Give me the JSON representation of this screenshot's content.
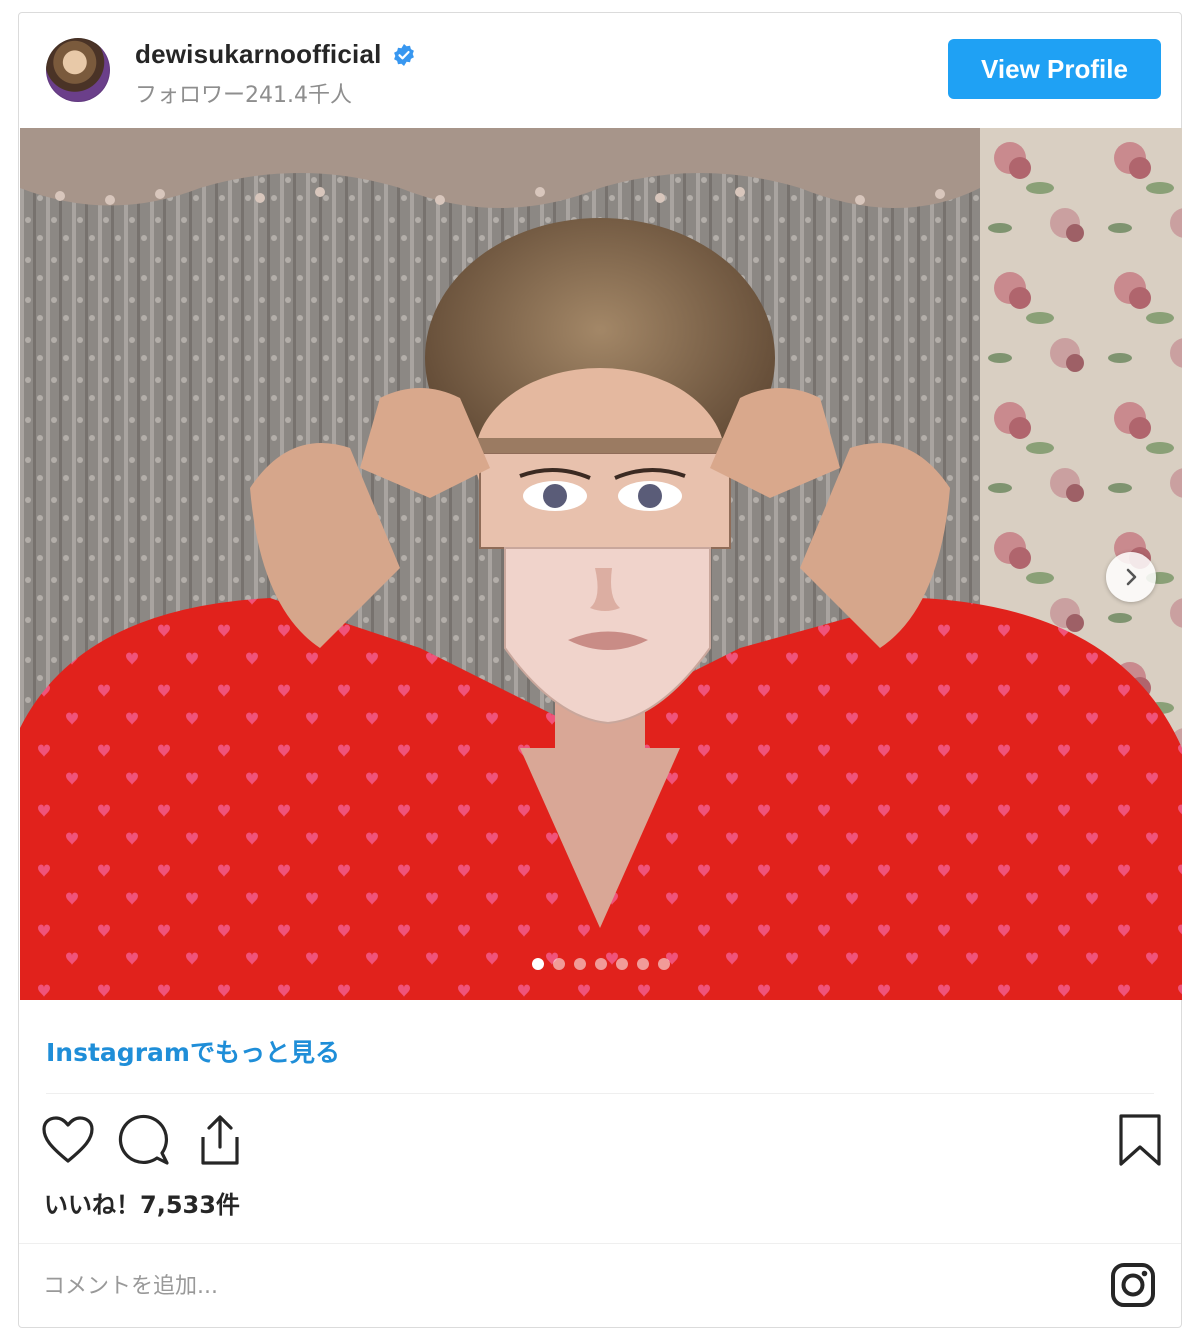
{
  "post": {
    "username": "dewisukarnoofficial",
    "followers": "フォロワー241.4千人",
    "view_profile_label": "View Profile"
  },
  "carousel": {
    "slide_count": 7,
    "active_index": 0
  },
  "more_link": "Instagramでもっと見る",
  "likes": "いいね！7,533件",
  "comment": {
    "placeholder": "コメントを追加..."
  },
  "colors": {
    "button_blue": "#1fa1f4",
    "link_blue": "#1f8ed8",
    "verified_blue": "#3897f0"
  },
  "icons": [
    "verified-badge-icon",
    "chevron-right-icon",
    "heart-icon",
    "comment-icon",
    "share-icon",
    "bookmark-icon",
    "instagram-icon"
  ]
}
